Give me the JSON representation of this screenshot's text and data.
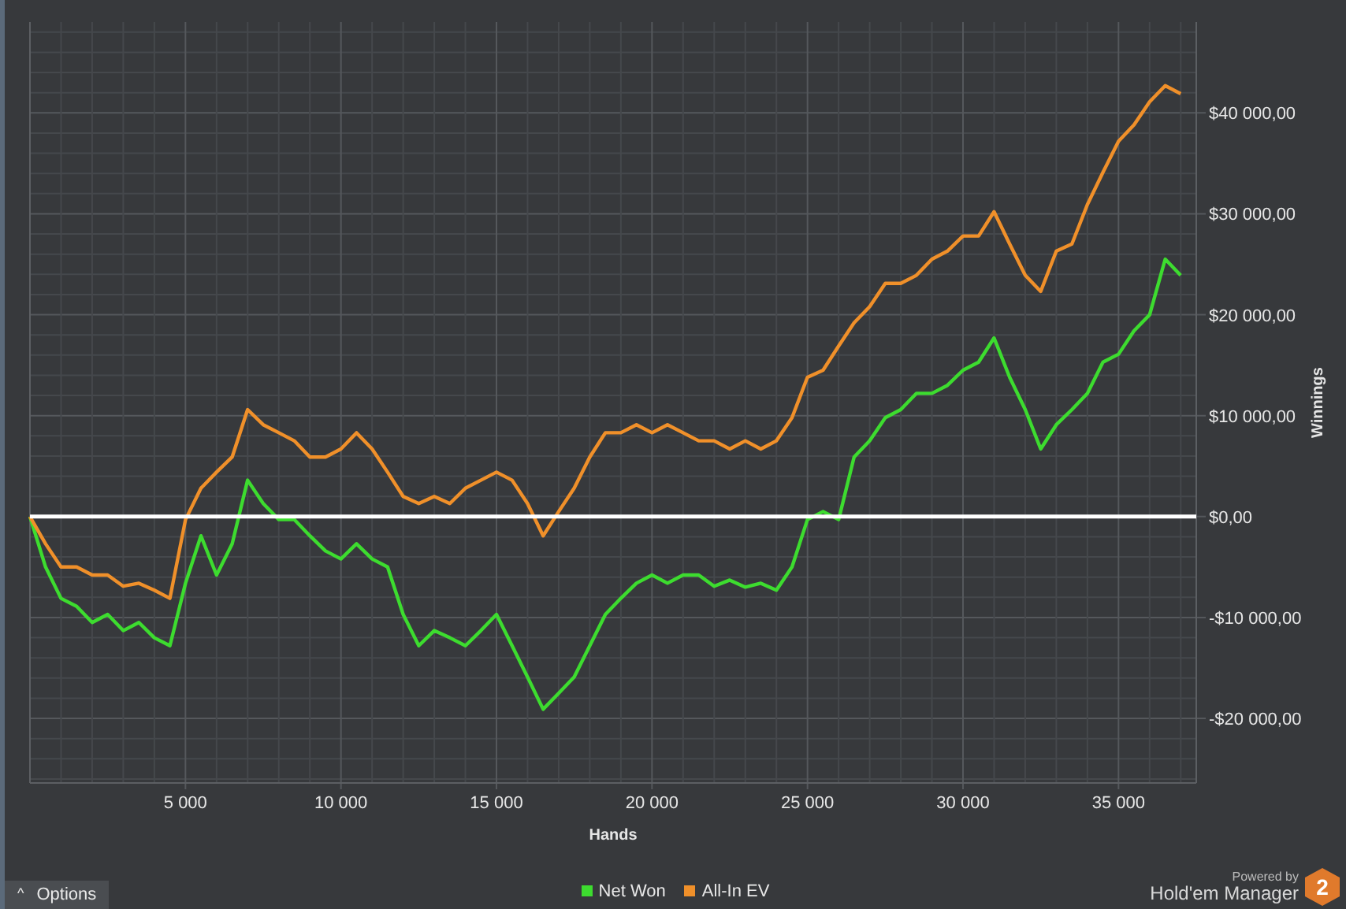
{
  "chart": {
    "chart_data": {
      "type": "line",
      "xlabel": "Hands",
      "ylabel": "Winnings",
      "x": [
        0,
        500,
        1000,
        1500,
        2000,
        2500,
        3000,
        3500,
        4000,
        4500,
        5000,
        5500,
        6000,
        6500,
        7000,
        7500,
        8000,
        8500,
        9000,
        9500,
        10000,
        10500,
        11000,
        11500,
        12000,
        12500,
        13000,
        13500,
        14000,
        14500,
        15000,
        15500,
        16000,
        16500,
        17000,
        17500,
        18000,
        18500,
        19000,
        19500,
        20000,
        20500,
        21000,
        21500,
        22000,
        22500,
        23000,
        23500,
        24000,
        24500,
        25000,
        25500,
        26000,
        26500,
        27000,
        27500,
        28000,
        28500,
        29000,
        29500,
        30000,
        30500,
        31000,
        31500,
        32000,
        32500,
        33000,
        33500,
        34000,
        34500,
        35000,
        35500,
        36000,
        36500,
        37000
      ],
      "series": [
        {
          "name": "Net Won",
          "color": "#3ddc2f",
          "values": [
            0,
            -5000,
            -8100,
            -8900,
            -10500,
            -9700,
            -11300,
            -10500,
            -12000,
            -12800,
            -6600,
            -1900,
            -5800,
            -2700,
            3600,
            1300,
            -300,
            -300,
            -1900,
            -3400,
            -4200,
            -2700,
            -4200,
            -5000,
            -9700,
            -12800,
            -11300,
            -12000,
            -12800,
            -11300,
            -9700,
            -12800,
            -15900,
            -19100,
            -17500,
            -15900,
            -12800,
            -9700,
            -8100,
            -6600,
            -5800,
            -6600,
            -5800,
            -5800,
            -6900,
            -6300,
            -7000,
            -6600,
            -7300,
            -5000,
            -300,
            500,
            -300,
            5900,
            7500,
            9800,
            10600,
            12200,
            12200,
            13000,
            14500,
            15300,
            17700,
            13800,
            10600,
            6700,
            9100,
            10600,
            12200,
            15300,
            16100,
            18400,
            20000,
            25500,
            23900
          ]
        },
        {
          "name": "All-In EV",
          "color": "#f0902a",
          "values": [
            0,
            -2700,
            -5000,
            -5000,
            -5800,
            -5800,
            -6900,
            -6600,
            -7300,
            -8100,
            -300,
            2800,
            4400,
            5900,
            10600,
            9100,
            8300,
            7500,
            5900,
            5900,
            6700,
            8300,
            6700,
            4400,
            2000,
            1300,
            2000,
            1300,
            2800,
            3600,
            4400,
            3600,
            1300,
            -1900,
            500,
            2800,
            5900,
            8300,
            8300,
            9100,
            8300,
            9100,
            8300,
            7500,
            7500,
            6700,
            7500,
            6700,
            7500,
            9800,
            13800,
            14500,
            16900,
            19200,
            20800,
            23100,
            23100,
            23900,
            25500,
            26300,
            27800,
            27800,
            30200,
            27000,
            23900,
            22300,
            26300,
            27000,
            30900,
            34100,
            37200,
            38800,
            41100,
            42700,
            41900
          ]
        }
      ],
      "xlim": [
        0,
        37500
      ],
      "ylim": [
        -26400,
        49000
      ],
      "xticks": [
        {
          "value": 5000,
          "label": "5 000"
        },
        {
          "value": 10000,
          "label": "10 000"
        },
        {
          "value": 15000,
          "label": "15 000"
        },
        {
          "value": 20000,
          "label": "20 000"
        },
        {
          "value": 25000,
          "label": "25 000"
        },
        {
          "value": 30000,
          "label": "30 000"
        },
        {
          "value": 35000,
          "label": "35 000"
        }
      ],
      "yticks": [
        {
          "value": -20000,
          "label": "-$20 000,00"
        },
        {
          "value": -10000,
          "label": "-$10 000,00"
        },
        {
          "value": 0,
          "label": "$0,00"
        },
        {
          "value": 10000,
          "label": "$10 000,00"
        },
        {
          "value": 20000,
          "label": "$20 000,00"
        },
        {
          "value": 30000,
          "label": "$30 000,00"
        },
        {
          "value": 40000,
          "label": "$40 000,00"
        }
      ],
      "grid": true,
      "ref_lines": [
        {
          "axis": "y",
          "value": 0
        }
      ]
    }
  },
  "options_button": {
    "label": "Options",
    "icon": "^"
  },
  "branding": {
    "tagline": "Powered by",
    "name": "Hold'em Manager",
    "badge": "2"
  }
}
